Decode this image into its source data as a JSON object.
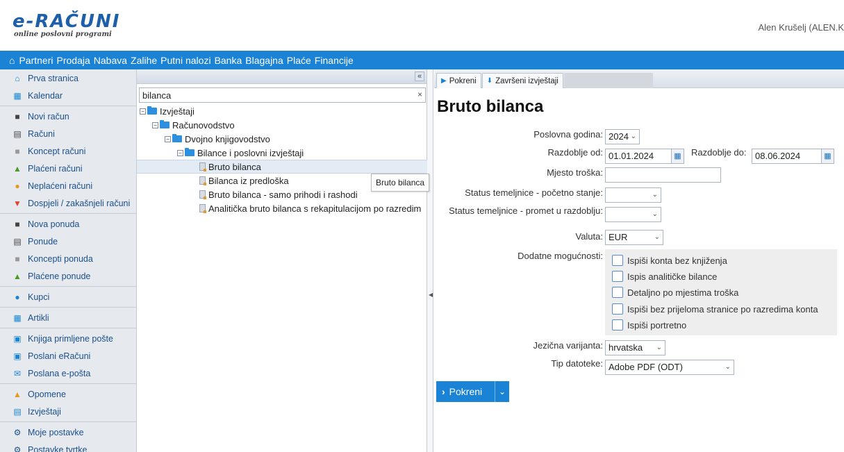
{
  "header": {
    "logo_main": "e-RAČUNI",
    "logo_sub": "online poslovni programi",
    "user": "Alen Krušelj (ALEN.K"
  },
  "topnav": {
    "items": [
      "Partneri",
      "Prodaja",
      "Nabava",
      "Zalihe",
      "Putni nalozi",
      "Banka",
      "Blagajna",
      "Plaće",
      "Financije"
    ]
  },
  "sidebar": {
    "items": [
      {
        "label": "Prva stranica",
        "icon": "home-icon"
      },
      {
        "label": "Kalendar",
        "icon": "calendar-icon"
      },
      {
        "label": "Novi račun",
        "icon": "new-document-icon"
      },
      {
        "label": "Računi",
        "icon": "document-icon"
      },
      {
        "label": "Koncept računi",
        "icon": "draft-icon"
      },
      {
        "label": "Plaćeni računi",
        "icon": "thumbs-up-icon"
      },
      {
        "label": "Neplaćeni računi",
        "icon": "hand-coin-icon"
      },
      {
        "label": "Dospjeli / zakašnjeli računi",
        "icon": "thumbs-down-icon"
      },
      {
        "label": "Nova ponuda",
        "icon": "new-document-icon"
      },
      {
        "label": "Ponude",
        "icon": "document-icon"
      },
      {
        "label": "Koncepti ponuda",
        "icon": "draft-icon"
      },
      {
        "label": "Plaćene ponude",
        "icon": "thumbs-up-icon"
      },
      {
        "label": "Kupci",
        "icon": "person-icon"
      },
      {
        "label": "Artikli",
        "icon": "boxes-icon"
      },
      {
        "label": "Knjiga primljene pošte",
        "icon": "inbox-icon"
      },
      {
        "label": "Poslani eRačuni",
        "icon": "sent-icon"
      },
      {
        "label": "Poslana e-pošta",
        "icon": "envelope-icon"
      },
      {
        "label": "Opomene",
        "icon": "bell-icon"
      },
      {
        "label": "Izvještaji",
        "icon": "chart-icon"
      },
      {
        "label": "Moje postavke",
        "icon": "gear-icon"
      },
      {
        "label": "Postavke tvrtke",
        "icon": "gears-icon"
      }
    ]
  },
  "tree": {
    "search_value": "bilanca",
    "clear_symbol": "×",
    "collapse_symbol": "«",
    "nodes": [
      {
        "label": "Izvještaji",
        "type": "folder"
      },
      {
        "label": "Računovodstvo",
        "type": "folder"
      },
      {
        "label": "Dvojno knjigovodstvo",
        "type": "folder"
      },
      {
        "label": "Bilance i poslovni izvještaji",
        "type": "folder"
      },
      {
        "label": "Bruto bilanca",
        "type": "report"
      },
      {
        "label": "Bilanca iz predloška",
        "type": "report"
      },
      {
        "label": "Bruto bilanca - samo prihodi i rashodi",
        "type": "report"
      },
      {
        "label": "Analitička bruto bilanca s rekapitulacijom po razredim",
        "type": "report"
      }
    ],
    "tooltip": "Bruto bilanca"
  },
  "tabs": {
    "run": "Pokreni",
    "finished": "Završeni izvještaji"
  },
  "form": {
    "title": "Bruto bilanca",
    "year_label": "Poslovna godina:",
    "year_value": "2024",
    "period_from_label": "Razdoblje od:",
    "period_from_value": "01.01.2024",
    "period_to_label": "Razdoblje do:",
    "period_to_value": "08.06.2024",
    "cost_place_label": "Mjesto troška:",
    "cost_place_value": "",
    "status_initial_label": "Status temeljnice - početno stanje:",
    "status_initial_value": "",
    "status_period_label": "Status temeljnice - promet u razdoblju:",
    "status_period_value": "",
    "currency_label": "Valuta:",
    "currency_value": "EUR",
    "options_label": "Dodatne mogućnosti:",
    "options": [
      "Ispiši konta bez knjiženja",
      "Ispis analitičke bilance",
      "Detaljno po mjestima troška",
      "Ispiši bez prijeloma stranice po razredima konta",
      "Ispiši portretno"
    ],
    "language_label": "Jezična varijanta:",
    "language_value": "hrvatska",
    "filetype_label": "Tip datoteke:",
    "filetype_value": "Adobe PDF (ODT)",
    "run_button": "Pokreni"
  },
  "colors": {
    "accent": "#1a83d6",
    "sidebar_bg": "#e6eaef",
    "link": "#1b4f8a"
  }
}
